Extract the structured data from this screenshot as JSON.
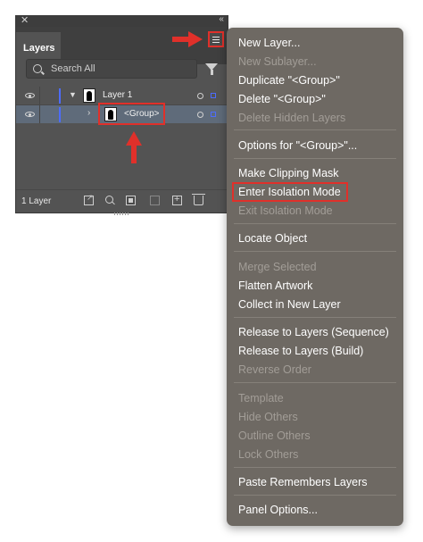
{
  "panel": {
    "tab_label": "Layers",
    "search_placeholder": "Search All",
    "layers": [
      {
        "name": "Layer 1",
        "expanded": true
      },
      {
        "name": "<Group>",
        "expanded": false,
        "selected": true
      }
    ],
    "layer_count": "1 Layer",
    "accent_color": "#4d6cff"
  },
  "annotations": {
    "highlight_color": "#e0302a"
  },
  "menu": {
    "items": [
      {
        "label": "New Layer...",
        "enabled": true
      },
      {
        "label": "New Sublayer...",
        "enabled": false
      },
      {
        "label": "Duplicate \"<Group>\"",
        "enabled": true
      },
      {
        "label": "Delete \"<Group>\"",
        "enabled": true
      },
      {
        "label": "Delete Hidden Layers",
        "enabled": false
      },
      {
        "label": "Options for \"<Group>\"...",
        "enabled": true
      },
      {
        "label": "Make Clipping Mask",
        "enabled": true
      },
      {
        "label": "Enter Isolation Mode",
        "enabled": true,
        "highlighted": true
      },
      {
        "label": "Exit Isolation Mode",
        "enabled": false
      },
      {
        "label": "Locate Object",
        "enabled": true
      },
      {
        "label": "Merge Selected",
        "enabled": false
      },
      {
        "label": "Flatten Artwork",
        "enabled": true
      },
      {
        "label": "Collect in New Layer",
        "enabled": true
      },
      {
        "label": "Release to Layers (Sequence)",
        "enabled": true
      },
      {
        "label": "Release to Layers (Build)",
        "enabled": true
      },
      {
        "label": "Reverse Order",
        "enabled": false
      },
      {
        "label": "Template",
        "enabled": false
      },
      {
        "label": "Hide Others",
        "enabled": false
      },
      {
        "label": "Outline Others",
        "enabled": false
      },
      {
        "label": "Lock Others",
        "enabled": false
      },
      {
        "label": "Paste Remembers Layers",
        "enabled": true
      },
      {
        "label": "Panel Options...",
        "enabled": true
      }
    ]
  }
}
